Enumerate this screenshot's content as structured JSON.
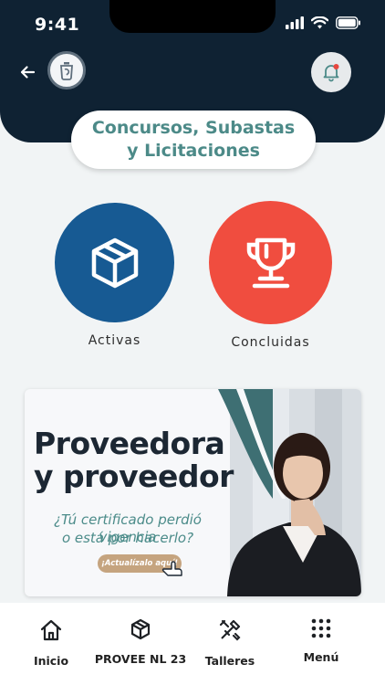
{
  "status_bar": {
    "time": "9:41"
  },
  "header": {
    "title_line1": "Concursos, Subastas",
    "title_line2": "y Licitaciones"
  },
  "categories": [
    {
      "label": "Activas",
      "color": "#175a93",
      "icon": "box-icon"
    },
    {
      "label": "Concluidas",
      "color": "#f04d3f",
      "icon": "trophy-icon"
    }
  ],
  "banner": {
    "headline_line1": "Proveedora",
    "headline_line2": "y proveedor",
    "sub_line1": "¿Tú certificado perdió vigencia",
    "sub_line2": "o está por hacerlo?",
    "cta": "¡Actualízalo aquí!"
  },
  "bottom_nav": [
    {
      "label": "Inicio",
      "icon": "home-icon"
    },
    {
      "label": "PROVEE NL 23",
      "icon": "box-icon"
    },
    {
      "label": "Talleres",
      "icon": "tools-icon"
    },
    {
      "label": "Menú",
      "icon": "grid-icon"
    }
  ],
  "colors": {
    "header": "#0f2233",
    "accent": "#4c8a88"
  }
}
